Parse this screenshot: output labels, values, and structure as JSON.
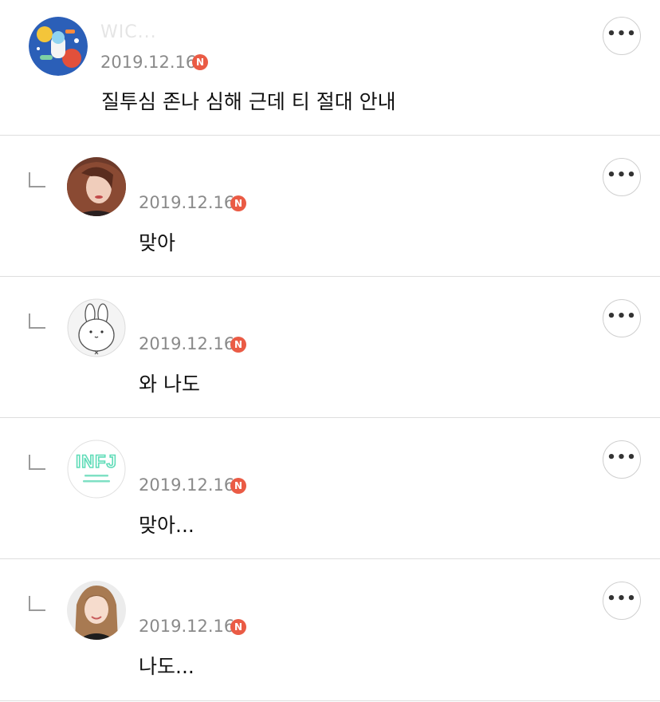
{
  "comments": [
    {
      "username": "WIC...",
      "date": "2019.12.16",
      "badge": "N",
      "text": "질투심 존나 심해 근데 티 절대 안내",
      "more_label": "•••",
      "avatar_icon": "astronaut-illustration-avatar"
    },
    {
      "username": "",
      "date": "2019.12.16",
      "badge": "N",
      "text": "맞아",
      "more_label": "•••",
      "avatar_icon": "portrait-photo-avatar"
    },
    {
      "username": "",
      "date": "2019.12.16",
      "badge": "N",
      "text": "와 나도",
      "more_label": "•••",
      "avatar_icon": "bunny-drawing-avatar"
    },
    {
      "username": "",
      "date": "2019.12.16",
      "badge": "N",
      "text": "맞아...",
      "more_label": "•••",
      "avatar_icon": "infj-logo-avatar",
      "avatar_text": "INFJ"
    },
    {
      "username": "",
      "date": "2019.12.16",
      "badge": "N",
      "text": "나도...",
      "more_label": "•••",
      "avatar_icon": "portrait-photo-avatar"
    }
  ],
  "colors": {
    "badge": "#ea5b45",
    "divider": "#dedede",
    "date": "#8a8a8a",
    "infj": "#5fdcb8"
  }
}
